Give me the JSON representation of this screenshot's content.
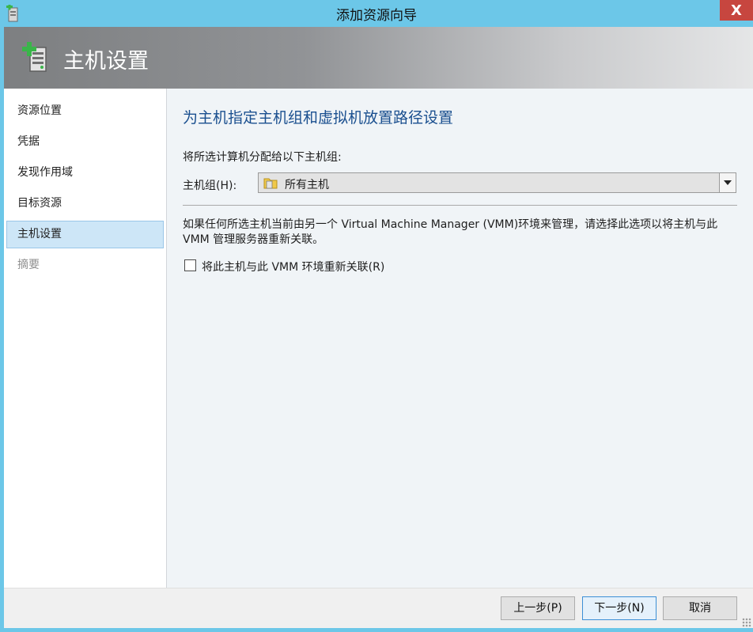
{
  "window": {
    "title": "添加资源向导",
    "close_label": "X"
  },
  "header": {
    "title": "主机设置"
  },
  "sidebar": {
    "items": [
      {
        "label": "资源位置",
        "state": "normal"
      },
      {
        "label": "凭据",
        "state": "normal"
      },
      {
        "label": "发现作用域",
        "state": "normal"
      },
      {
        "label": "目标资源",
        "state": "normal"
      },
      {
        "label": "主机设置",
        "state": "active"
      },
      {
        "label": "摘要",
        "state": "disabled"
      }
    ]
  },
  "main": {
    "heading": "为主机指定主机组和虚拟机放置路径设置",
    "group_instruction": "将所选计算机分配给以下主机组:",
    "host_group_label": "主机组(H):",
    "host_group_value": "所有主机",
    "info_text": "如果任何所选主机当前由另一个 Virtual Machine Manager (VMM)环境来管理，请选择此选项以将主机与此 VMM 管理服务器重新关联。",
    "reassociate_checkbox": {
      "label": "将此主机与此 VMM 环境重新关联(R)",
      "checked": false
    }
  },
  "footer": {
    "previous_label": "上一步(P)",
    "next_label": "下一步(N)",
    "cancel_label": "取消"
  },
  "colors": {
    "accent": "#1a4f8f",
    "titlebar": "#6cc7e8",
    "close": "#c7463f",
    "selection": "#cde6f7"
  }
}
